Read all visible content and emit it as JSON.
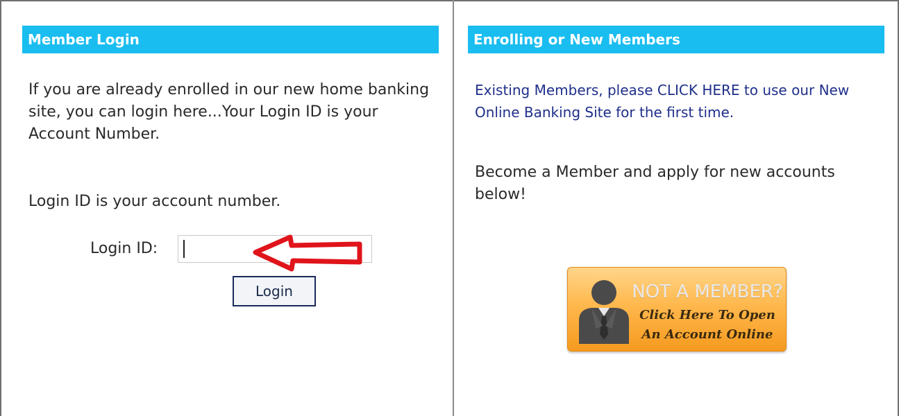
{
  "left_panel": {
    "header": "Member Login",
    "intro": "If you are already enrolled in our new home banking site, you can login here...Your Login ID is your Account Number.",
    "note": "Login ID is your account number.",
    "login_label": "Login ID:",
    "login_input": {
      "value": "",
      "placeholder": ""
    },
    "login_button": "Login"
  },
  "right_panel": {
    "header": "Enrolling or New Members",
    "existing_members_link": "Existing Members, please CLICK HERE to use our New Online Banking Site for the first time.",
    "become_member": "Become a Member and apply for new accounts below!",
    "cta_banner": {
      "title": "NOT A MEMBER?",
      "line1": "Click Here To Open",
      "line2": "An Account Online"
    }
  },
  "colors": {
    "header_bg": "#19bdf0",
    "link": "#1f2f8a",
    "annotation_arrow": "#e0141b",
    "cta_orange": "#f59a1f"
  },
  "icons": {
    "annotation": "red-arrow-left-icon",
    "member": "person-silhouette-icon"
  }
}
